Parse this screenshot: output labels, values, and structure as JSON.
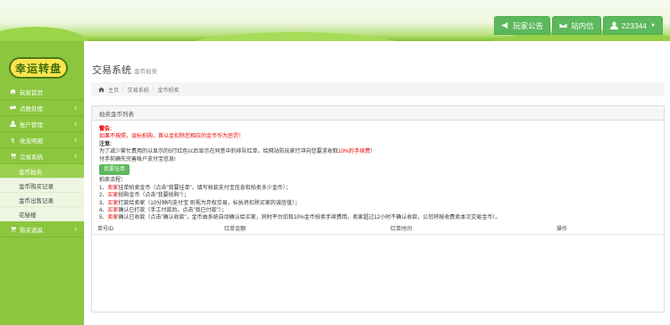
{
  "topnav": {
    "notice": "玩家公告",
    "mail": "站内信",
    "user": "223344"
  },
  "logo": "幸运转盘",
  "menu": [
    {
      "label": "玩家首页",
      "icon": "home-icon",
      "chevron": ""
    },
    {
      "label": "点数处理",
      "icon": "transfer-icon",
      "chevron": "‹"
    },
    {
      "label": "账户管理",
      "icon": "user-icon",
      "chevron": "‹"
    },
    {
      "label": "收支明细",
      "icon": "money-icon",
      "chevron": "‹"
    },
    {
      "label": "交易系统",
      "icon": "cart-icon",
      "chevron": "‹"
    }
  ],
  "submenu": [
    "金币拍卖",
    "金币购买记录",
    "金币出售记录",
    "花秘楼"
  ],
  "menu_last": {
    "label": "购买道具",
    "icon": "cart-icon",
    "chevron": "‹"
  },
  "page": {
    "title": "交易系统",
    "subtitle": "金币拍卖"
  },
  "breadcrumb": [
    "主页",
    "交易系统",
    "金币拍卖"
  ],
  "panel": {
    "title": "拍卖金币列表",
    "warn_head": "警告:",
    "warn_text": "如果不按照，误标拍购，首以金扣除您相应的金币作为惩罚！",
    "note_head": "注意:",
    "note_text_a": "为了减少繁忙费用的以显示的5行红色以后显示在同意中的排队红单，给网站防玩家行冲向您要求收取",
    "note_text_b": "10%的手续费",
    "note_text_c": "！",
    "note_line2": "付手前确先完善帐户支付宝信息!",
    "button": "我要挂单",
    "flow_head": "拍卖流程：",
    "steps": [
      {
        "n": "1、",
        "role": "卖家",
        "text": "挂单拍卖金币（点击\"我要挂单\"，填写收款支付宝信息和拍卖多少金币）；"
      },
      {
        "n": "2、",
        "role": "买家",
        "text": "拍购金币（点击\"我要拍购\"）；"
      },
      {
        "n": "3、",
        "role": "买家",
        "text": "打款给卖家（10分钟内支付宝 则视为弃权交易，标执将扣除买家的诚信值）；"
      },
      {
        "n": "4、",
        "role": "买家",
        "text": "确认已打款（手工付款后，点击\"我已付款\"）；"
      },
      {
        "n": "5、",
        "role": "卖家",
        "text": "确认已收款（点击\"确认收款\"，金币由系统自动确认给买家，同时平台扣取10%金币拍卖手续费用。卖家超过12小时不确认收款，公司将按收费卖本次交易金币）。"
      }
    ],
    "columns": [
      "单号ID",
      "红单金额",
      "红单时间",
      "操作"
    ]
  },
  "colors": {
    "green": "#5cb85c",
    "sidebar": "#8cc63f",
    "red": "#e00000"
  }
}
